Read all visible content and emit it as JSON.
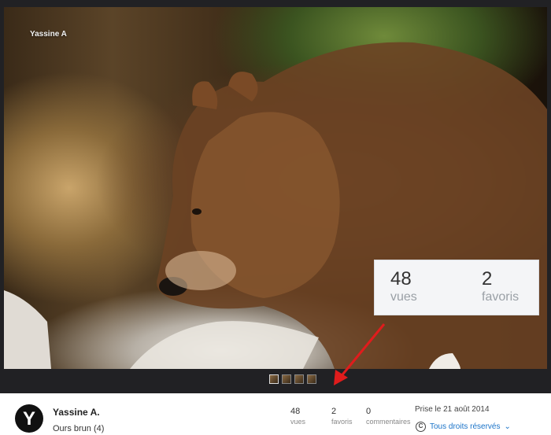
{
  "photo": {
    "photographer_overlay": "Yassine A",
    "stats_popup": {
      "views_count": "48",
      "views_label": "vues",
      "faves_count": "2",
      "faves_label": "favoris"
    }
  },
  "filmstrip": {
    "thumbnail_count": 4
  },
  "info": {
    "avatar_letter": "Y",
    "owner_name": "Yassine A.",
    "photo_title": "Ours brun (4)",
    "stats": [
      {
        "value": "48",
        "label": "vues"
      },
      {
        "value": "2",
        "label": "favoris"
      },
      {
        "value": "0",
        "label": "commentaires"
      }
    ],
    "taken_on": "Prise le 21 août 2014",
    "license_label": "Tous droits réservés",
    "license_icon": "copyright-circle-icon"
  },
  "colors": {
    "viewer_background": "#212124",
    "annotation_arrow": "#e01c1c",
    "link_blue": "#1a73c8"
  }
}
